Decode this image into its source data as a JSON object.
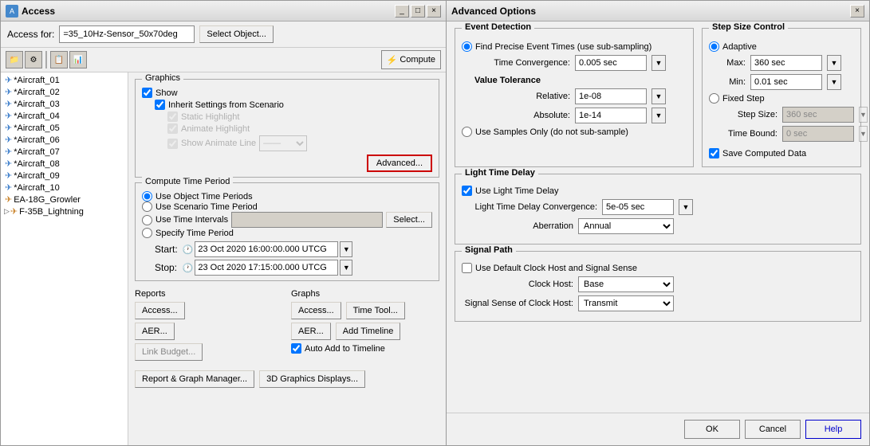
{
  "access_window": {
    "title": "Access",
    "access_for_label": "Access for:",
    "access_for_value": "=35_10Hz-Sensor_50x70deg",
    "select_object_btn": "Select Object...",
    "compute_btn": "Compute",
    "tree_items": [
      {
        "label": "*Aircraft_01",
        "selected": false
      },
      {
        "label": "*Aircraft_02",
        "selected": false
      },
      {
        "label": "*Aircraft_03",
        "selected": false
      },
      {
        "label": "*Aircraft_04",
        "selected": false
      },
      {
        "label": "*Aircraft_05",
        "selected": false
      },
      {
        "label": "*Aircraft_06",
        "selected": false
      },
      {
        "label": "*Aircraft_07",
        "selected": false
      },
      {
        "label": "*Aircraft_08",
        "selected": false
      },
      {
        "label": "*Aircraft_09",
        "selected": false
      },
      {
        "label": "*Aircraft_10",
        "selected": false
      },
      {
        "label": "EA-18G_Growler",
        "selected": false
      },
      {
        "label": "F-35B_Lightning",
        "selected": false
      }
    ],
    "graphics": {
      "title": "Graphics",
      "show_label": "Show",
      "inherit_label": "Inherit Settings from Scenario",
      "static_highlight_label": "Static Highlight",
      "animate_highlight_label": "Animate Highlight",
      "show_animate_line_label": "Show Animate Line",
      "advanced_btn": "Advanced..."
    },
    "compute_time": {
      "title": "Compute Time Period",
      "use_object_label": "Use Object Time Periods",
      "use_scenario_label": "Use Scenario Time Period",
      "use_intervals_label": "Use Time Intervals",
      "specify_label": "Specify Time Period",
      "start_label": "Start:",
      "start_value": "23 Oct 2020 16:00:00.000 UTCG",
      "stop_label": "Stop:",
      "stop_value": "23 Oct 2020 17:15:00.000 UTCG",
      "select_btn": "Select..."
    },
    "reports": {
      "title": "Reports",
      "access_btn": "Access...",
      "aer_btn": "AER...",
      "link_budget_btn": "Link Budget..."
    },
    "graphs": {
      "title": "Graphs",
      "access_btn": "Access...",
      "time_tool_btn": "Time Tool...",
      "aer_btn": "AER...",
      "add_timeline_btn": "Add Timeline",
      "auto_add_label": "Auto Add to Timeline"
    },
    "footer": {
      "report_graph_btn": "Report & Graph Manager...",
      "displays_btn": "3D Graphics Displays..."
    }
  },
  "advanced_window": {
    "title": "Advanced Options",
    "close_btn": "×",
    "event_detection": {
      "title": "Event Detection",
      "find_precise_label": "Find Precise Event Times (use sub-sampling)",
      "use_samples_label": "Use Samples Only (do not sub-sample)",
      "time_convergence_label": "Time Convergence:",
      "time_convergence_value": "0.005 sec",
      "value_tolerance_label": "Value Tolerance",
      "relative_label": "Relative:",
      "relative_value": "1e-08",
      "absolute_label": "Absolute:",
      "absolute_value": "1e-14"
    },
    "light_time_delay": {
      "title": "Light Time Delay",
      "use_label": "Use Light Time Delay",
      "convergence_label": "Light Time Delay Convergence:",
      "convergence_value": "5e-05 sec",
      "aberration_label": "Aberration",
      "aberration_value": "Annual"
    },
    "signal_path": {
      "title": "Signal Path",
      "use_default_label": "Use Default Clock Host and Signal Sense",
      "clock_host_label": "Clock Host:",
      "clock_host_value": "Base",
      "signal_sense_label": "Signal Sense of Clock Host:",
      "signal_sense_value": "Transmit"
    },
    "step_size": {
      "title": "Step Size Control",
      "adaptive_label": "Adaptive",
      "max_label": "Max:",
      "max_value": "360 sec",
      "min_label": "Min:",
      "min_value": "0.01 sec",
      "fixed_step_label": "Fixed Step",
      "step_size_label": "Step Size:",
      "step_size_value": "360 sec",
      "time_bound_label": "Time Bound:",
      "time_bound_value": "0 sec",
      "save_data_label": "Save Computed Data"
    },
    "footer": {
      "ok_btn": "OK",
      "cancel_btn": "Cancel",
      "help_btn": "Help"
    }
  }
}
